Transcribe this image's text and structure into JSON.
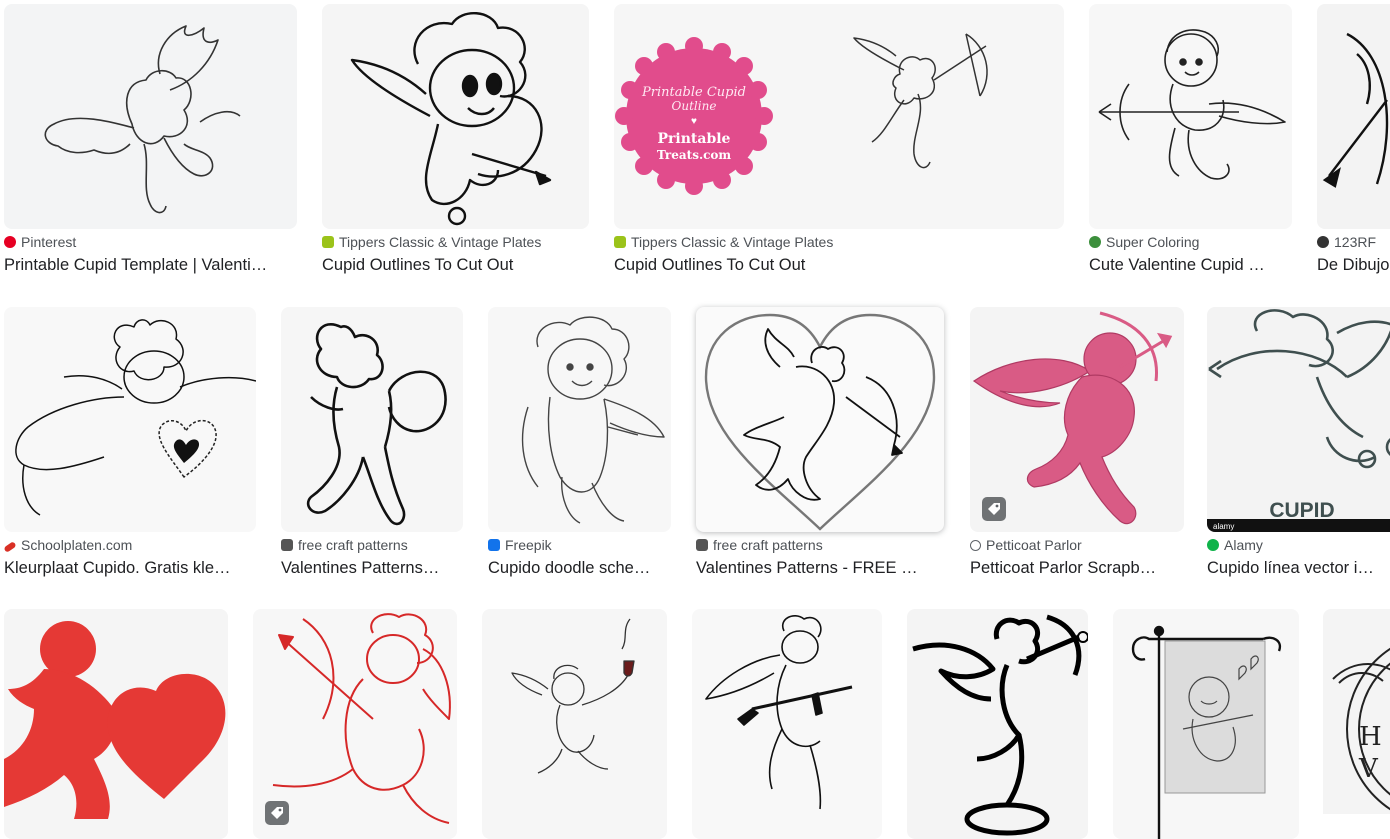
{
  "results": [
    {
      "source": "Pinterest",
      "title": "Printable Cupid Template | Valenti…",
      "favicon": "pinterest-icon",
      "favicon_color": "#e60023"
    },
    {
      "source": "Tippers Classic & Vintage Plates",
      "title": "Cupid Outlines To Cut Out",
      "favicon": "tippers-icon",
      "favicon_color": "#9bc31a"
    },
    {
      "source": "Tippers Classic & Vintage Plates",
      "title": "Cupid Outlines To Cut Out",
      "favicon": "tippers-icon",
      "favicon_color": "#9bc31a",
      "image_text": {
        "line1": "Printable Cupid",
        "line2": "Outline",
        "line3": "Printable",
        "line4": "Treats.com"
      }
    },
    {
      "source": "Super Coloring",
      "title": "Cute Valentine Cupid …",
      "favicon": "super-coloring-icon",
      "favicon_color": "#3c8f3c"
    },
    {
      "source": "123RF",
      "title": "De Dibujo",
      "favicon": "123rf-icon",
      "favicon_color": "#333333"
    },
    {
      "source": "Schoolplaten.com",
      "title": "Kleurplaat Cupido. Gratis kle…",
      "favicon": "schoolplaten-icon",
      "favicon_color": "#d93025"
    },
    {
      "source": "free craft patterns",
      "title": "Valentines Patterns…",
      "favicon": "free-craft-patterns-icon",
      "favicon_color": "#555555"
    },
    {
      "source": "Freepik",
      "title": "Cupido doodle sche…",
      "favicon": "freepik-icon",
      "favicon_color": "#1273eb"
    },
    {
      "source": "free craft patterns",
      "title": "Valentines Patterns - FREE …",
      "favicon": "free-craft-patterns-icon",
      "favicon_color": "#555555"
    },
    {
      "source": "Petticoat Parlor",
      "title": "Petticoat Parlor Scrapb…",
      "favicon": "globe-icon",
      "favicon_color": "#5f6368"
    },
    {
      "source": "Alamy",
      "title": "Cupido línea vector i…",
      "favicon": "alamy-icon",
      "favicon_color": "#0fb34a",
      "image_text": {
        "caption": "CUPID",
        "watermark": "alamy"
      }
    },
    {
      "source": "",
      "title": ""
    },
    {
      "source": "",
      "title": ""
    },
    {
      "source": "",
      "title": ""
    },
    {
      "source": "",
      "title": ""
    },
    {
      "source": "",
      "title": ""
    },
    {
      "source": "",
      "title": ""
    },
    {
      "source": "",
      "title": ""
    }
  ]
}
